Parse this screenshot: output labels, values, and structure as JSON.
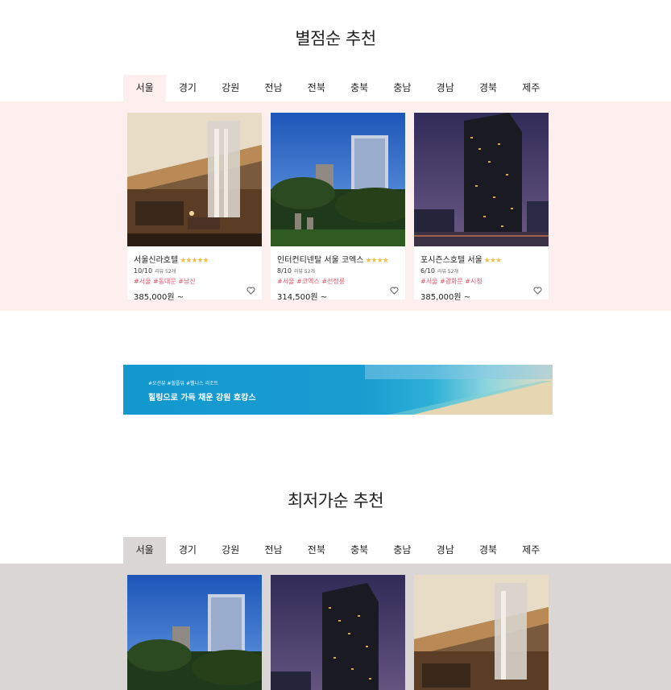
{
  "section1": {
    "title": "별점순 추천",
    "tabs": [
      "서울",
      "경기",
      "강원",
      "전남",
      "전북",
      "충북",
      "충남",
      "경남",
      "경북",
      "제주"
    ],
    "active_tab": "서울",
    "cards": [
      {
        "name": "서울신라호텔",
        "stars": "★★★★★",
        "score": "10/10",
        "reviews": "리뷰 52개",
        "tags": "#서울 #동대문 #남산",
        "price": "385,000원 ~"
      },
      {
        "name": "인터컨티넨탈 서울 코엑스",
        "stars": "★★★★",
        "score": "8/10",
        "reviews": "리뷰 52개",
        "tags": "#서울 #코엑스 #선정릉",
        "price": "314,500원 ~"
      },
      {
        "name": "포시즌스호텔 서울",
        "stars": "★★★",
        "score": "6/10",
        "reviews": "리뷰 52개",
        "tags": "#서울 #광화문 #시청",
        "price": "385,000원 ~"
      }
    ]
  },
  "banner": {
    "tags": "#오션뷰 #힐플뷰 #웰니스 리조트",
    "title": "힐링으로 가득 채운 강원 호캉스"
  },
  "section2": {
    "title": "최저가순 추천",
    "tabs": [
      "서울",
      "경기",
      "강원",
      "전남",
      "전북",
      "충북",
      "충남",
      "경남",
      "경북",
      "제주"
    ],
    "active_tab": "서울"
  },
  "colors": {
    "pink_band": "#fcefee",
    "grey_band": "#d9d6d5",
    "tag_color": "#e0566a",
    "star_color": "#f2c04a"
  }
}
